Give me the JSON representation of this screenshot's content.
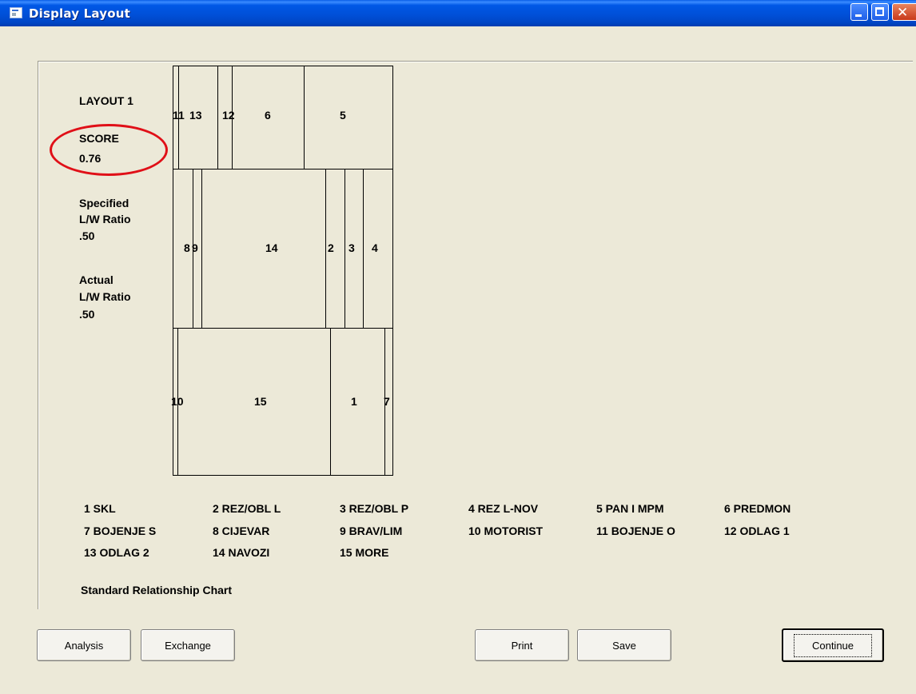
{
  "window": {
    "title": "Display Layout"
  },
  "info": {
    "layout_label": "LAYOUT 1",
    "score_label": "SCORE",
    "score_value": "0.76",
    "specified_line1": "Specified",
    "specified_line2": "L/W Ratio",
    "specified_value": ".50",
    "actual_line1": "Actual",
    "actual_line2": "L/W Ratio",
    "actual_value": ".50"
  },
  "diagram": {
    "cells": [
      "11",
      "13",
      "12",
      "6",
      "5",
      "8",
      "9",
      "14",
      "2",
      "3",
      "4",
      "10",
      "15",
      "1",
      "7"
    ]
  },
  "legend": [
    "1  SKL",
    "2  REZ/OBL L",
    "3  REZ/OBL P",
    "4  REZ L-NOV",
    "5  PAN I MPM",
    "6  PREDMON",
    "7  BOJENJE S",
    "8  CIJEVAR",
    "9  BRAV/LIM",
    "10  MOTORIST",
    "11  BOJENJE O",
    "12  ODLAG 1",
    "13  ODLAG 2",
    "14  NAVOZI",
    "15  MORE"
  ],
  "chart_name": "Standard Relationship Chart",
  "buttons": {
    "analysis": "Analysis",
    "exchange": "Exchange",
    "print": "Print",
    "save": "Save",
    "continue": "Continue"
  },
  "colors": {
    "titlebar": "#0054E3",
    "window_bg": "#ECE9D8",
    "annotation": "#E01018"
  }
}
